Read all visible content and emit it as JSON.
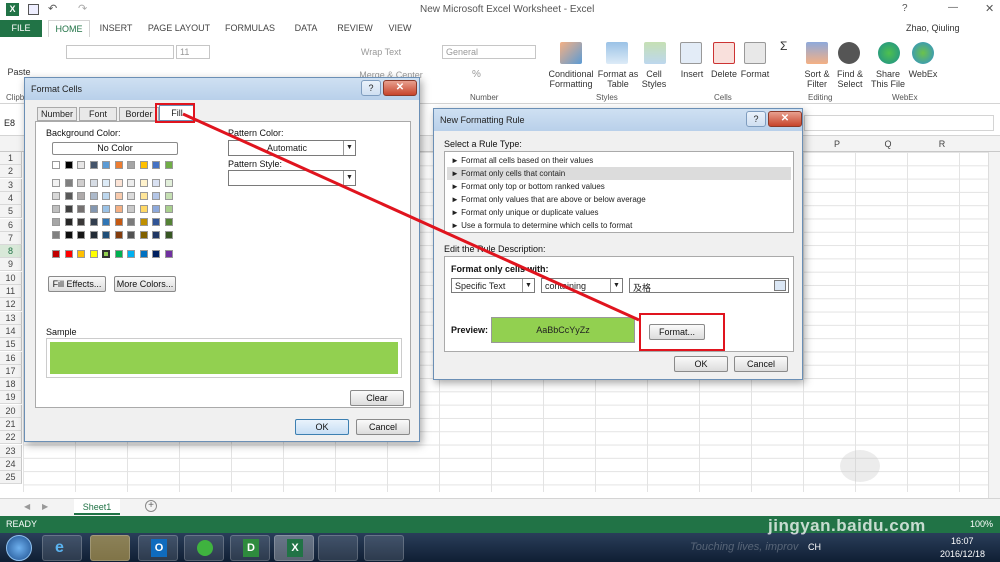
{
  "window": {
    "title": "New Microsoft Excel Worksheet - Excel",
    "user": "Zhao, Qiuling"
  },
  "tabs": [
    "FILE",
    "HOME",
    "INSERT",
    "PAGE LAYOUT",
    "FORMULAS",
    "DATA",
    "REVIEW",
    "VIEW"
  ],
  "ribbon": {
    "font_size": "11",
    "wrap_text": "Wrap Text",
    "merge": "Merge & Center",
    "number_format": "General",
    "conditional_formatting": "Conditional Formatting",
    "format_as_table": "Format as Table",
    "cell_styles": "Cell Styles",
    "insert": "Insert",
    "delete": "Delete",
    "format": "Format",
    "sort_filter": "Sort & Filter",
    "find_select": "Find & Select",
    "share_file": "Share This File",
    "webex": "WebEx",
    "paste": "Paste",
    "groups": {
      "clipboard": "Clipb",
      "number": "Number",
      "styles": "Styles",
      "cells": "Cells",
      "editing": "Editing",
      "webex": "WebEx"
    }
  },
  "namebox": "E8",
  "columns": [
    "P",
    "Q",
    "R"
  ],
  "rows": [
    "1",
    "2",
    "3",
    "4",
    "5",
    "6",
    "7",
    "8",
    "9",
    "10",
    "11",
    "12",
    "13",
    "14",
    "15",
    "16",
    "17",
    "18",
    "19",
    "20",
    "21",
    "22",
    "23",
    "24",
    "25"
  ],
  "sheet_tab": "Sheet1",
  "status": {
    "ready": "READY",
    "zoom": "100%"
  },
  "taskbar": {
    "lang": "CH",
    "time": "16:07",
    "date": "2016/12/18",
    "watermark_text": "Touching lives, improv"
  },
  "watermark": {
    "site": "jingyan.baidu.com"
  },
  "format_cells": {
    "title": "Format Cells",
    "tabs": [
      "Number",
      "Font",
      "Border",
      "Fill"
    ],
    "background_color": "Background Color:",
    "no_color": "No Color",
    "fill_effects": "Fill Effects...",
    "more_colors": "More Colors...",
    "pattern_color": "Pattern Color:",
    "pattern_color_value": "Automatic",
    "pattern_style": "Pattern Style:",
    "sample": "Sample",
    "sample_color": "#92d050",
    "clear": "Clear",
    "ok": "OK",
    "cancel": "Cancel",
    "palette_top": [
      "#ffffff",
      "#000000",
      "#e7e6e6",
      "#44546a",
      "#5b9bd5",
      "#ed7d31",
      "#a5a5a5",
      "#ffc000",
      "#4472c4",
      "#70ad47"
    ],
    "palette_shades": [
      [
        "#f2f2f2",
        "#808080",
        "#d0cece",
        "#d6dce4",
        "#ddebf7",
        "#fce4d6",
        "#ededed",
        "#fff2cc",
        "#d9e1f2",
        "#e2efda"
      ],
      [
        "#d9d9d9",
        "#595959",
        "#aeaaaa",
        "#acb9ca",
        "#bdd7ee",
        "#f8cbad",
        "#dbdbdb",
        "#ffe699",
        "#b4c6e7",
        "#c6e0b4"
      ],
      [
        "#bfbfbf",
        "#404040",
        "#757171",
        "#8497b0",
        "#9bc2e6",
        "#f4b084",
        "#c9c9c9",
        "#ffd966",
        "#8ea9db",
        "#a9d08e"
      ],
      [
        "#a6a6a6",
        "#262626",
        "#3a3838",
        "#333f4f",
        "#2f75b5",
        "#c65911",
        "#7b7b7b",
        "#bf8f00",
        "#305496",
        "#548235"
      ],
      [
        "#808080",
        "#0d0d0d",
        "#161616",
        "#222b35",
        "#1f4e78",
        "#833c0c",
        "#525252",
        "#806000",
        "#203764",
        "#375623"
      ]
    ],
    "palette_standard": [
      "#c00000",
      "#ff0000",
      "#ffc000",
      "#ffff00",
      "#92d050",
      "#00b050",
      "#00b0f0",
      "#0070c0",
      "#002060",
      "#7030a0"
    ]
  },
  "new_rule": {
    "title": "New Formatting Rule",
    "select_type": "Select a Rule Type:",
    "rule_types": [
      "► Format all cells based on their values",
      "► Format only cells that contain",
      "► Format only top or bottom ranked values",
      "► Format only values that are above or below average",
      "► Format only unique or duplicate values",
      "► Use a formula to determine which cells to format"
    ],
    "edit_desc": "Edit the Rule Description:",
    "format_only": "Format only cells with:",
    "cond1": "Specific Text",
    "cond2": "containing",
    "value": "及格",
    "preview": "Preview:",
    "preview_text": "AaBbCcYyZz",
    "preview_color": "#92d050",
    "format_btn": "Format...",
    "ok": "OK",
    "cancel": "Cancel"
  }
}
